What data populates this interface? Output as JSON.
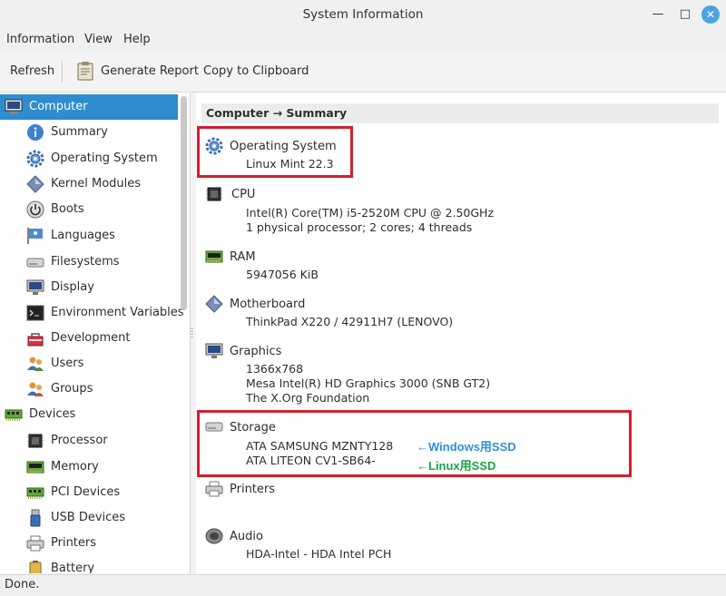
{
  "window": {
    "title": "System Information"
  },
  "menu": [
    "Information",
    "View",
    "Help"
  ],
  "toolbar": {
    "refresh": "Refresh",
    "generate_report": "Generate Report",
    "copy": "Copy to Clipboard"
  },
  "sidebar": {
    "items": [
      {
        "label": "Computer",
        "icon": "monitor-icon",
        "selected": true
      },
      {
        "label": "Summary",
        "icon": "info-icon"
      },
      {
        "label": "Operating System",
        "icon": "gear-icon"
      },
      {
        "label": "Kernel Modules",
        "icon": "diamond-icon"
      },
      {
        "label": "Boots",
        "icon": "power-icon"
      },
      {
        "label": "Languages",
        "icon": "flag-icon"
      },
      {
        "label": "Filesystems",
        "icon": "drive-icon"
      },
      {
        "label": "Display",
        "icon": "display-icon"
      },
      {
        "label": "Environment Variables",
        "icon": "terminal-icon"
      },
      {
        "label": "Development",
        "icon": "toolbox-icon"
      },
      {
        "label": "Users",
        "icon": "users-icon"
      },
      {
        "label": "Groups",
        "icon": "groups-icon"
      },
      {
        "label": "Devices",
        "icon": "pci-card-icon"
      },
      {
        "label": "Processor",
        "icon": "cpu-icon"
      },
      {
        "label": "Memory",
        "icon": "ram-icon"
      },
      {
        "label": "PCI Devices",
        "icon": "pci-card-icon"
      },
      {
        "label": "USB Devices",
        "icon": "usb-icon"
      },
      {
        "label": "Printers",
        "icon": "printer-icon"
      },
      {
        "label": "Battery",
        "icon": "battery-icon"
      }
    ]
  },
  "content": {
    "breadcrumb": "Computer → Summary",
    "sections": {
      "os": {
        "title": "Operating System",
        "lines": [
          "Linux Mint 22.3"
        ]
      },
      "cpu": {
        "title": "CPU",
        "lines": [
          "Intel(R) Core(TM) i5-2520M CPU @ 2.50GHz",
          "1 physical processor; 2 cores; 4 threads"
        ]
      },
      "ram": {
        "title": "RAM",
        "lines": [
          "5947056 KiB"
        ]
      },
      "motherboard": {
        "title": "Motherboard",
        "lines": [
          "ThinkPad X220 / 42911H7 (LENOVO)"
        ]
      },
      "graphics": {
        "title": "Graphics",
        "lines": [
          "1366x768",
          "Mesa Intel(R) HD Graphics 3000 (SNB GT2)",
          "The X.Org Foundation"
        ]
      },
      "storage": {
        "title": "Storage",
        "lines": [
          "ATA SAMSUNG MZNTY128",
          "ATA LITEON CV1-SB64-"
        ]
      },
      "printers": {
        "title": "Printers",
        "lines": []
      },
      "audio": {
        "title": "Audio",
        "lines": [
          "HDA-Intel - HDA Intel PCH"
        ]
      }
    },
    "annotations": {
      "windows": "←Windows用SSD",
      "linux": "←Linux用SSD"
    }
  },
  "status": "Done.",
  "colors": {
    "selection": "#2e8ccf",
    "highlight_box": "#d21f2c",
    "annot_windows": "#2f8fdc",
    "annot_linux": "#1aa544"
  }
}
